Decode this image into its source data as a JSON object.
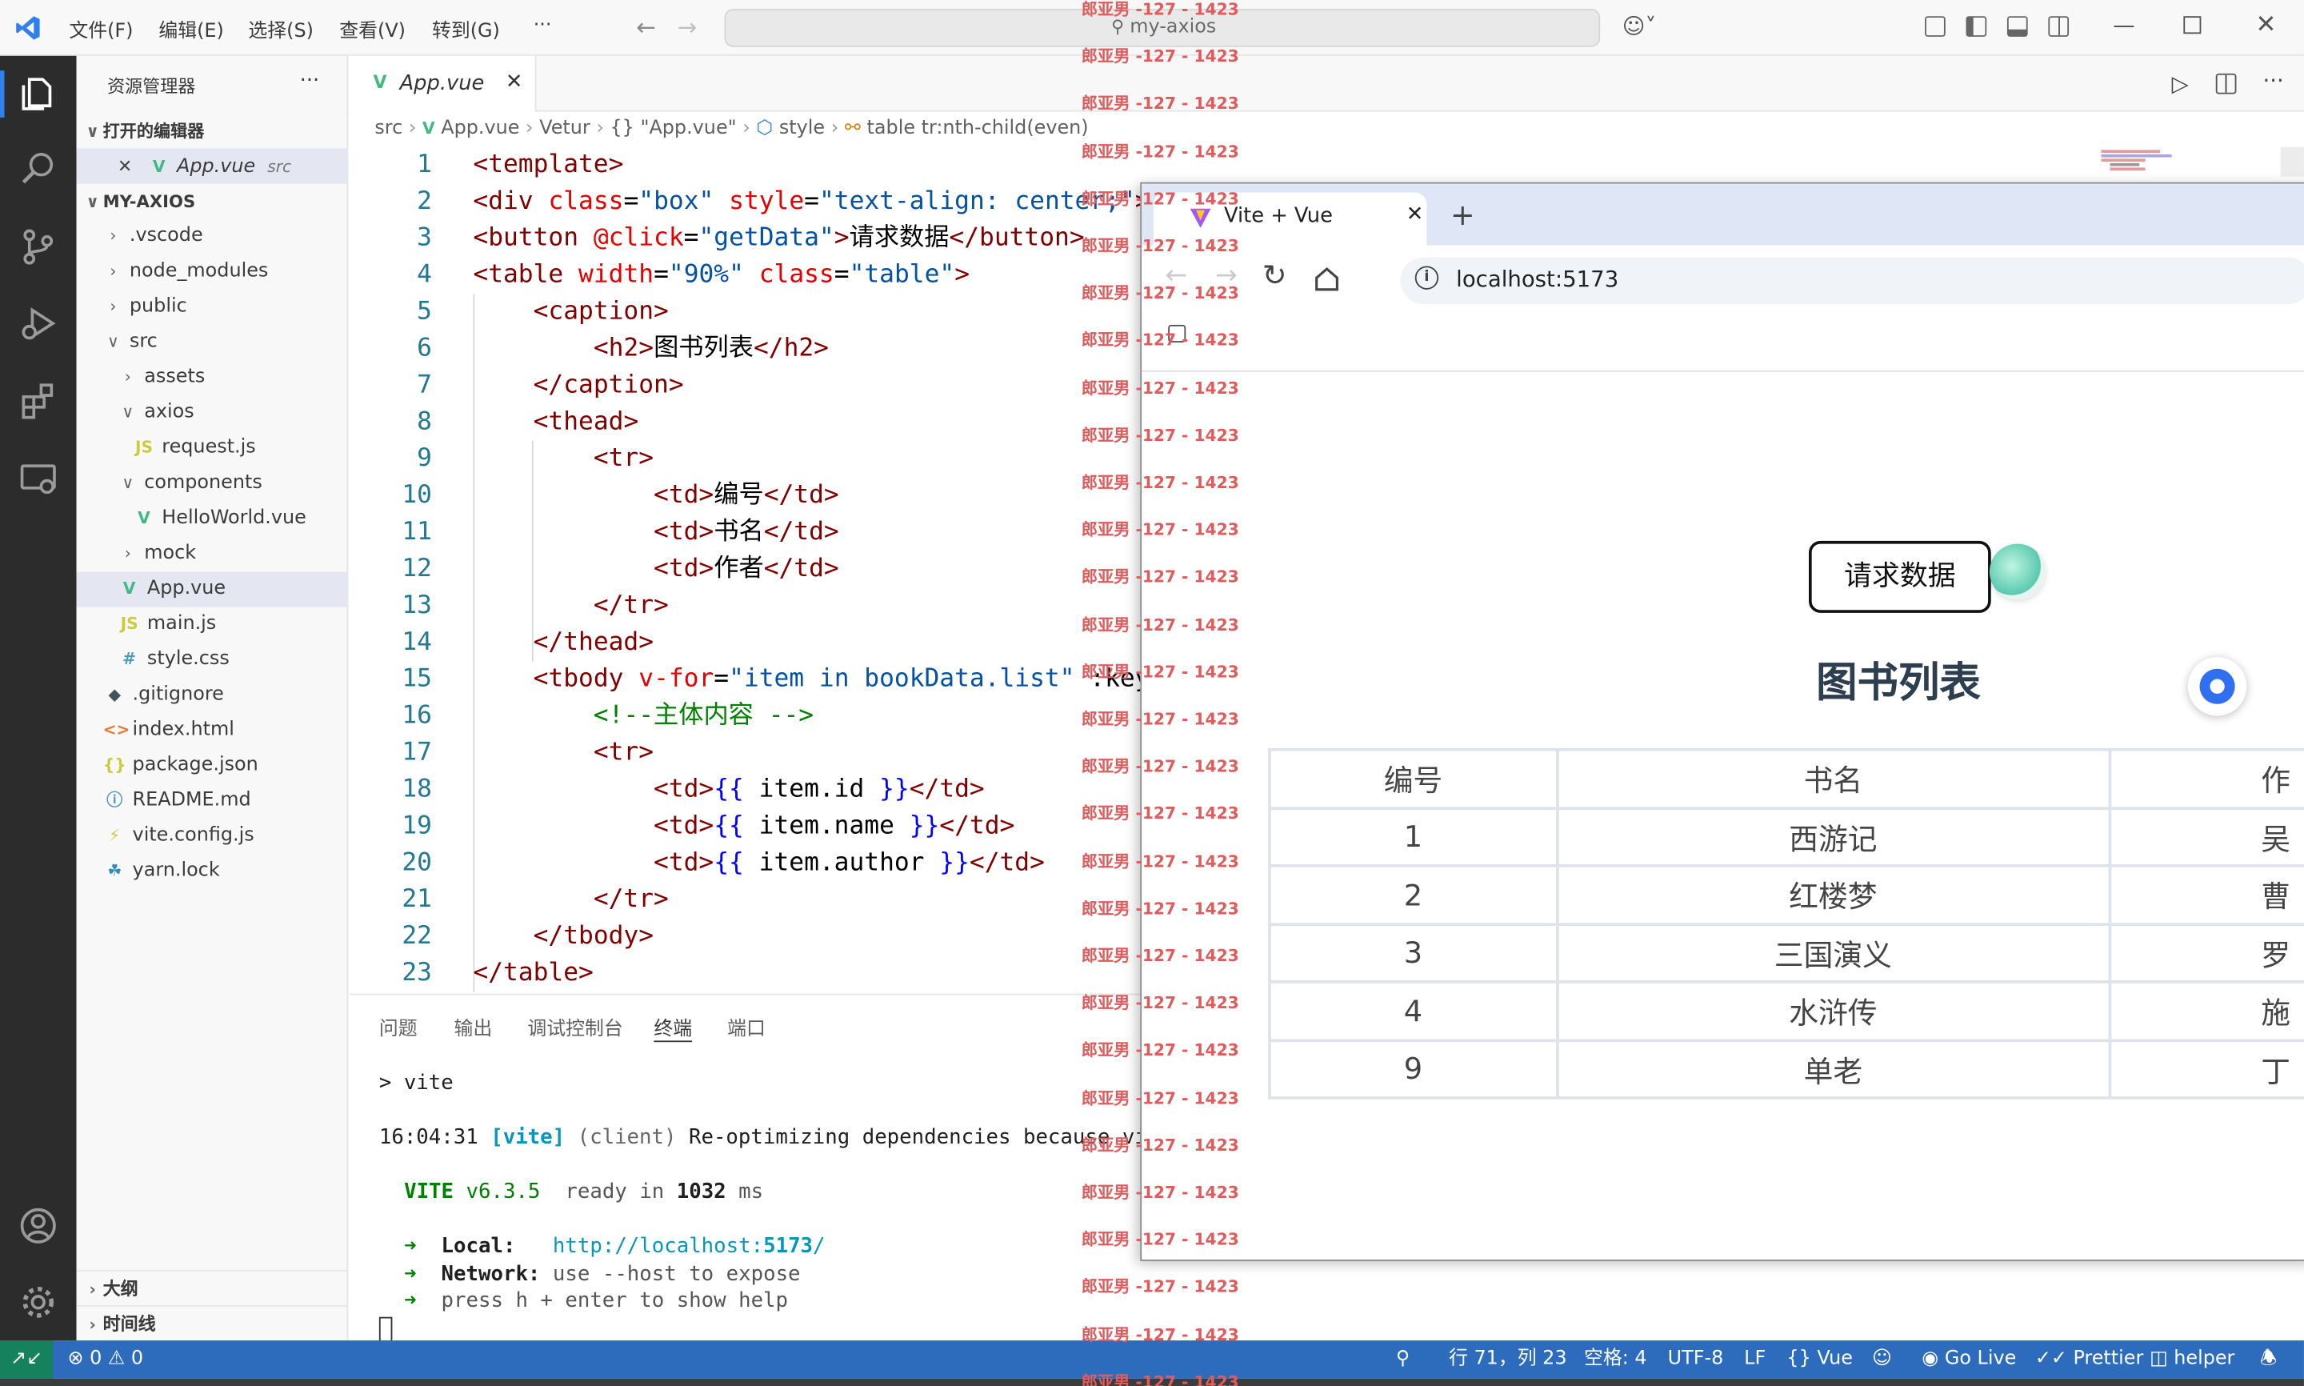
{
  "titlebar": {
    "menus": [
      "文件(F)",
      "编辑(E)",
      "选择(S)",
      "查看(V)",
      "转到(G)",
      "···"
    ],
    "search_text": "my-axios"
  },
  "sidebar": {
    "title": "资源管理器",
    "more": "···",
    "open_editors_header": "打开的编辑器",
    "open_editor_file": "App.vue",
    "open_editor_dir": "src",
    "project_header": "MY-AXIOS",
    "tree": [
      {
        "label": ".vscode",
        "kind": "folder",
        "depth": 1
      },
      {
        "label": "node_modules",
        "kind": "folder",
        "depth": 1
      },
      {
        "label": "public",
        "kind": "folder",
        "depth": 1
      },
      {
        "label": "src",
        "kind": "folder-open",
        "depth": 1
      },
      {
        "label": "assets",
        "kind": "folder",
        "depth": 2
      },
      {
        "label": "axios",
        "kind": "folder-open",
        "depth": 2
      },
      {
        "label": "request.js",
        "kind": "js",
        "depth": 3
      },
      {
        "label": "components",
        "kind": "folder-open",
        "depth": 2
      },
      {
        "label": "HelloWorld.vue",
        "kind": "vue",
        "depth": 3
      },
      {
        "label": "mock",
        "kind": "folder",
        "depth": 2
      },
      {
        "label": "App.vue",
        "kind": "vue",
        "depth": 2,
        "selected": true
      },
      {
        "label": "main.js",
        "kind": "js",
        "depth": 2
      },
      {
        "label": "style.css",
        "kind": "css",
        "depth": 2
      },
      {
        "label": ".gitignore",
        "kind": "git",
        "depth": 1
      },
      {
        "label": "index.html",
        "kind": "html",
        "depth": 1
      },
      {
        "label": "package.json",
        "kind": "json",
        "depth": 1
      },
      {
        "label": "README.md",
        "kind": "info",
        "depth": 1
      },
      {
        "label": "vite.config.js",
        "kind": "vite",
        "depth": 1
      },
      {
        "label": "yarn.lock",
        "kind": "yarn",
        "depth": 1
      }
    ],
    "outline": "大纲",
    "timeline": "时间线"
  },
  "editor": {
    "tab_label": "App.vue",
    "breadcrumb": [
      "src",
      "App.vue",
      "Vetur",
      "{} \"App.vue\"",
      "style",
      "table tr:nth-child(even)"
    ],
    "line_numbers": [
      "1",
      "2",
      "3",
      "4",
      "5",
      "6",
      "7",
      "8",
      "9",
      "10",
      "11",
      "12",
      "13",
      "14",
      "15",
      "16",
      "17",
      "18",
      "19",
      "20",
      "21",
      "22",
      "23"
    ],
    "lines": [
      "<template>",
      "<div class=\"box\" style=\"text-align: center;\">",
      "<button @click=\"getData\">请求数据</button>",
      "<table width=\"90%\" class=\"table\">",
      "    <caption>",
      "        <h2>图书列表</h2>",
      "    </caption>",
      "    <thead>",
      "        <tr>",
      "            <td>编号</td>",
      "            <td>书名</td>",
      "            <td>作者</td>",
      "        </tr>",
      "    </thead>",
      "    <tbody v-for=\"item in bookData.list\" :key",
      "        <!--主体内容 -->",
      "        <tr>",
      "            <td>{{ item.id }}</td>",
      "            <td>{{ item.name }}</td>",
      "            <td>{{ item.author }}</td>",
      "        </tr>",
      "    </tbody>",
      "</table>"
    ]
  },
  "panel": {
    "tabs": [
      "问题",
      "输出",
      "调试控制台",
      "终端",
      "端口"
    ],
    "active_tab": "终端",
    "terminal": {
      "cmd": "> vite",
      "time": "16:04:31",
      "vite_tag": "[vite]",
      "client": "(client)",
      "message": "Re-optimizing dependencies because vit",
      "vite_name": "VITE",
      "vite_version": "v6.3.5",
      "ready": "ready in",
      "ready_ms": "1032",
      "ms": "ms",
      "local_label": "Local:",
      "local_url_prefix": "http://localhost:",
      "local_port": "5173",
      "local_url_suffix": "/",
      "network_label": "Network:",
      "network_text": "use --host to expose",
      "help_text": "press h + enter to show help",
      "arrow": "➜"
    }
  },
  "statusbar": {
    "errors": "0",
    "warnings": "0",
    "position": "行 71，列 23",
    "spaces": "空格: 4",
    "encoding": "UTF-8",
    "eol": "LF",
    "language": "Vue",
    "golive": "Go Live",
    "prettier": "Prettier",
    "helper": "helper"
  },
  "browser": {
    "tab_title": "Vite + Vue",
    "url": "localhost:5173",
    "button": "请求数据",
    "caption": "图书列表",
    "headers": [
      "编号",
      "书名",
      "作"
    ],
    "rows": [
      [
        "1",
        "西游记",
        "吴"
      ],
      [
        "2",
        "红楼梦",
        "曹"
      ],
      [
        "3",
        "三国演义",
        "罗"
      ],
      [
        "4",
        "水浒传",
        "施"
      ],
      [
        "9",
        "单老",
        "丁"
      ]
    ]
  },
  "watermark": {
    "text": "郎亚男 -127 - 1423"
  },
  "colors": {
    "status_bar": "#2d6bbd",
    "activity_bar": "#2c2c2c",
    "vue_green": "#42b883",
    "watermark": "#e05c5c"
  }
}
